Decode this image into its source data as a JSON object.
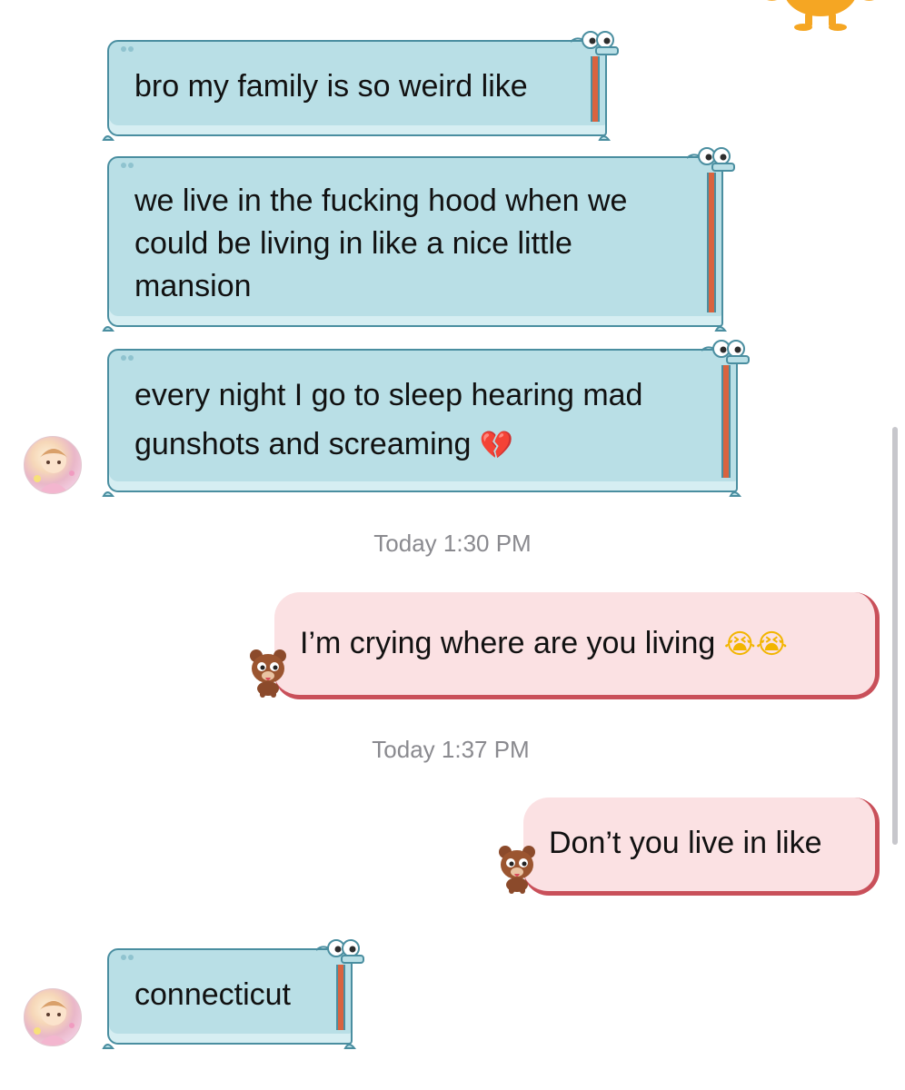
{
  "messages": {
    "m1": "bro my family is so weird like",
    "m2_l1": "we live in the fucking hood when we",
    "m2_l2": "could be living in like a nice little",
    "m2_l3": "mansion",
    "m3_l1": "every night I go to sleep hearing mad",
    "m3_l2": "gunshots and screaming",
    "m3_emoji": "💔",
    "m4": "I’m crying where are you living",
    "m4_emoji": "😭😭",
    "m5": "Don’t you live in like",
    "m6": "connecticut"
  },
  "timestamps": {
    "t1": "Today 1:30 PM",
    "t2": "Today 1:37 PM"
  },
  "colors": {
    "incoming_bubble": "#b9dfe6",
    "incoming_border": "#4a8ea0",
    "outgoing_bubble": "#fbe1e3",
    "outgoing_accent": "#c9505a",
    "timestamp_text": "#8a8a8f"
  },
  "icons": {
    "incoming_decoration": "crocodile-icon",
    "outgoing_decoration": "bear-icon",
    "corner_mascot": "orange-mascot-icon",
    "contact_avatar": "anime-avatar"
  }
}
